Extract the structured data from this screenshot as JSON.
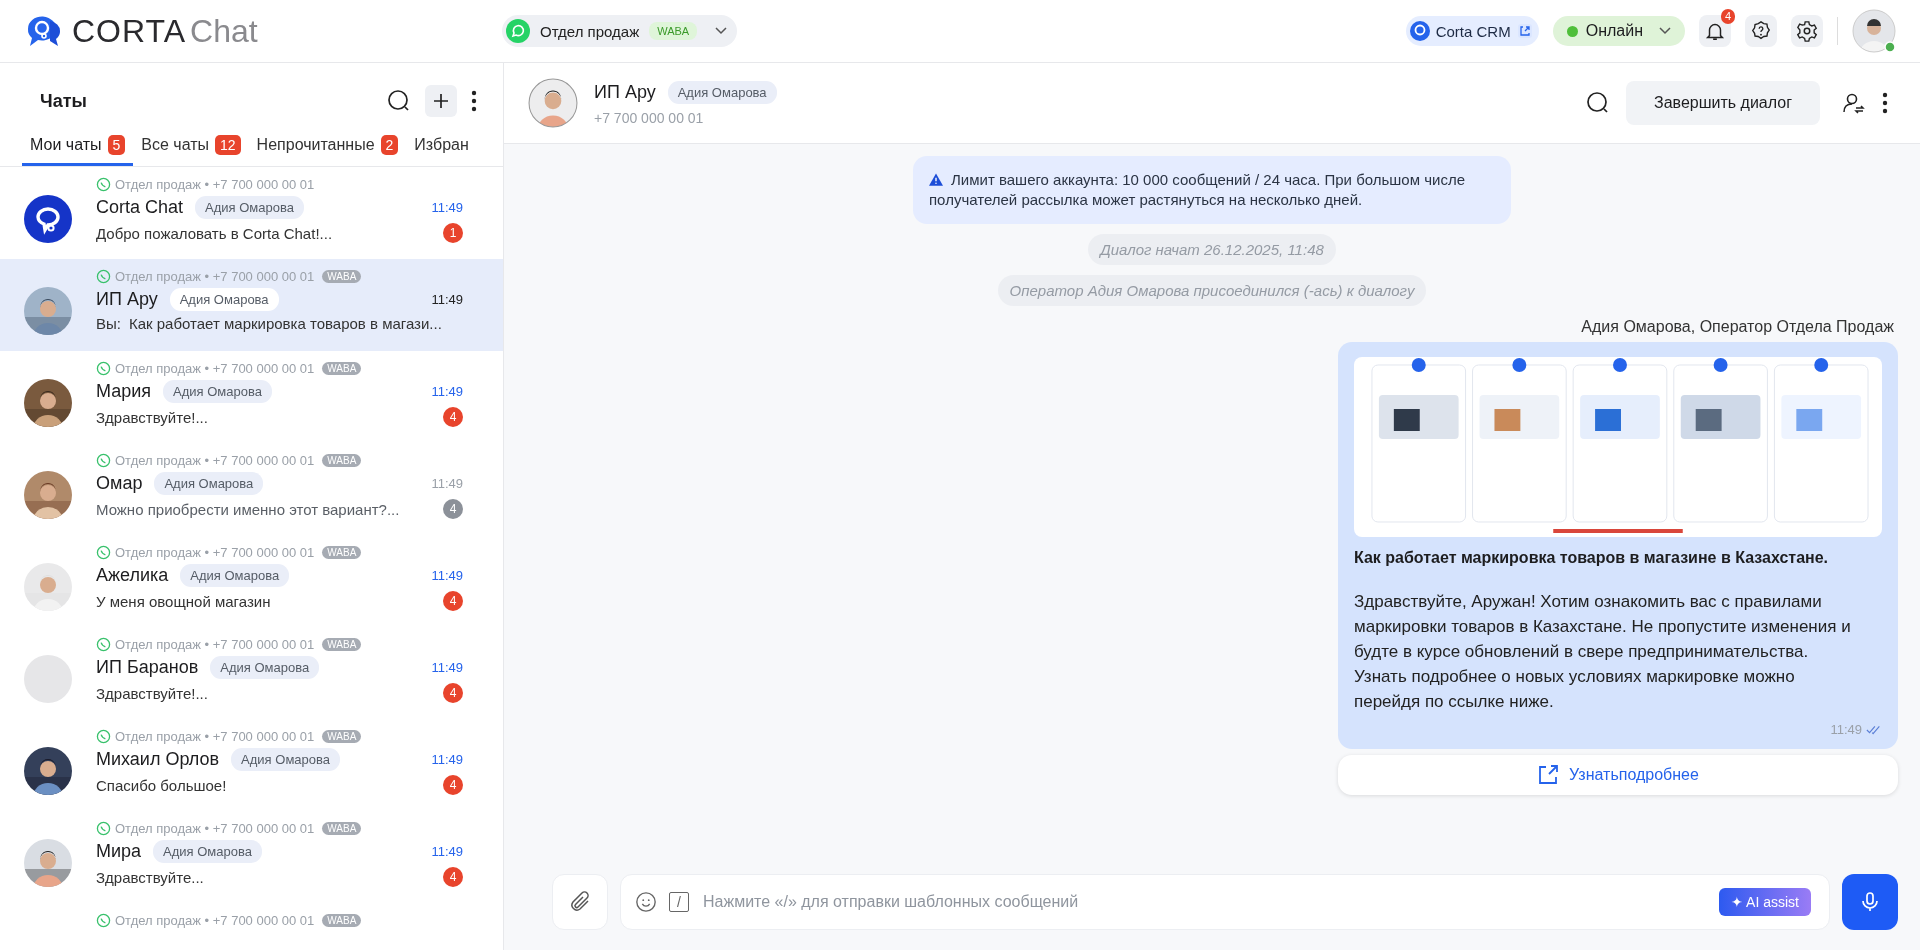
{
  "app": {
    "logo_primary": "CORTA",
    "logo_secondary": "Chat"
  },
  "channel_selector": {
    "name": "Отдел продаж",
    "badge": "WABA"
  },
  "top_bar": {
    "crm_link": "Corta CRM",
    "status": "Онлайн",
    "notifications": "4"
  },
  "sidebar": {
    "title": "Чаты",
    "tabs": [
      {
        "label": "Мои чаты",
        "count": "5",
        "selected": true
      },
      {
        "label": "Все чаты",
        "count": "12",
        "selected": false
      },
      {
        "label": "Непрочитанные",
        "count": "2",
        "selected": false
      },
      {
        "label": "Избран",
        "selected": false
      }
    ],
    "chats": [
      {
        "kind": "logo",
        "meta": "Отдел продаж • +7 700 000 00 01",
        "name": "Corta Chat",
        "agent": "Адия Омарова",
        "time": "11:49",
        "preview": "Добро пожаловать в Corta Chat!...",
        "unread": "1",
        "muted": false,
        "selected": false
      },
      {
        "meta": "Отдел продаж • +7 700 000 00 01",
        "badge": "WABA",
        "name": "ИП Ару",
        "agent": "Адия Омарова",
        "time": "11:49",
        "sender": "Вы:",
        "preview": "Как работает маркировка товаров в магази...",
        "selected": true
      },
      {
        "meta": "Отдел продаж • +7 700 000 00 01",
        "badge": "WABA",
        "name": "Мария",
        "agent": "Адия Омарова",
        "time": "11:49",
        "preview": "Здравствуйте!...",
        "unread": "4",
        "muted": false,
        "selected": false
      },
      {
        "meta": "Отдел продаж • +7 700 000 00 01",
        "badge": "WABA",
        "name": "Омар",
        "agent": "Адия Омарова",
        "time": "11:49",
        "preview": "Можно приобрести именно этот вариант?...",
        "unread": "4",
        "muted": true,
        "selected": false
      },
      {
        "meta": "Отдел продаж • +7 700 000 00 01",
        "badge": "WABA",
        "name": "Ажелика",
        "agent": "Адия Омарова",
        "time": "11:49",
        "preview": "У меня овощной магазин",
        "unread": "4",
        "muted": false,
        "selected": false
      },
      {
        "kind": "blank",
        "meta": "Отдел продаж • +7 700 000 00 01",
        "badge": "WABA",
        "name": "ИП Баранов",
        "agent": "Адия Омарова",
        "time": "11:49",
        "preview": "Здравствуйте!...",
        "unread": "4",
        "muted": false,
        "selected": false
      },
      {
        "meta": "Отдел продаж • +7 700 000 00 01",
        "badge": "WABA",
        "name": "Михаил Орлов",
        "agent": "Адия Омарова",
        "time": "11:49",
        "preview": "Спасибо большое!",
        "unread": "4",
        "muted": false,
        "selected": false
      },
      {
        "meta": "Отдел продаж • +7 700 000 00 01",
        "badge": "WABA",
        "name": "Мира",
        "agent": "Адия Омарова",
        "time": "11:49",
        "preview": "Здравствуйте...",
        "unread": "4",
        "muted": false,
        "selected": false
      },
      {
        "kind": "partial",
        "meta": "Отдел продаж • +7 700 000 00 01",
        "badge": "WABA"
      }
    ]
  },
  "conversation": {
    "name": "ИП Ару",
    "agent": "Адия Омарова",
    "phone": "+7 700 000 00 01",
    "end_button": "Завершить диалог",
    "notice": "Лимит вашего аккаунта: 10 000 сообщений / 24 часа. При большом числе получателей рассылка может растянуться на несколько дней.",
    "events": [
      "Диалог начат 26.12.2025, 11:48",
      "Оператор Адия Омарова присоединился (-ась) к диалогу"
    ],
    "message": {
      "author": "Адия Омарова, Оператор Отдела Продаж",
      "title": "Как работает маркировка товаров в магазине в Казахстане.",
      "body": "Здравствуйте, Аружан! Хотим ознакомить вас с правилами маркировки товаров в Казахстане. Не пропустите изменения и будте в курсе обновлений в свере предпринимательства. Узнать подробнее о новых условиях маркировке можно перейдя по ссылке ниже.",
      "time": "11:49",
      "read": true,
      "link_button": "Узнатьподробнее"
    }
  },
  "composer": {
    "placeholder": "Нажмите «/» для отправки шаблонных сообщений",
    "slash_key": "/",
    "ai_button": "✦ AI assist"
  }
}
